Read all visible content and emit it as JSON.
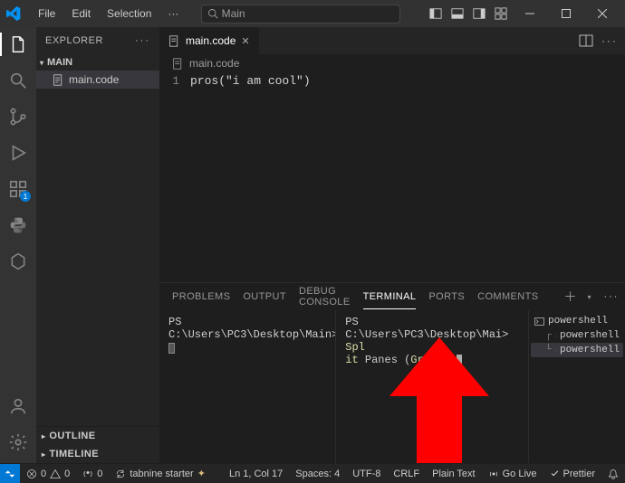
{
  "menu": {
    "file": "File",
    "edit": "Edit",
    "selection": "Selection",
    "more": "···"
  },
  "title_search": {
    "text": "Main"
  },
  "sidebar": {
    "header": "EXPLORER",
    "section": "MAIN",
    "items": [
      {
        "label": "main.code"
      }
    ],
    "outline": "OUTLINE",
    "timeline": "TIMELINE"
  },
  "activity": {
    "ext_badge": "1"
  },
  "tab": {
    "label": "main.code"
  },
  "breadcrumb": {
    "file": "main.code"
  },
  "code": {
    "line_no": "1",
    "text": "pros(\"i am cool\")"
  },
  "panel": {
    "problems": "PROBLEMS",
    "output": "OUTPUT",
    "debug": "DEBUG CONSOLE",
    "terminal": "TERMINAL",
    "ports": "PORTS",
    "comments": "COMMENTS"
  },
  "term": {
    "left_prompt": "PS C:\\Users\\PC3\\Desktop\\Main>",
    "right_line1a": "PS C:\\Users\\PC3\\Desktop\\Mai>",
    "right_line1b": " Spl",
    "right_line2a": "it",
    "right_line2b": " Panes (",
    "right_line2c": "Groups",
    "right_line2d": ")"
  },
  "term_list": {
    "powershell": "powershell"
  },
  "status": {
    "errors": "0",
    "warnings": "0",
    "ports": "0",
    "tabnine": "tabnine starter",
    "lncol": "Ln 1, Col 17",
    "spaces": "Spaces: 4",
    "encoding": "UTF-8",
    "eol": "CRLF",
    "lang": "Plain Text",
    "golive": "Go Live",
    "prettier": "Prettier"
  }
}
